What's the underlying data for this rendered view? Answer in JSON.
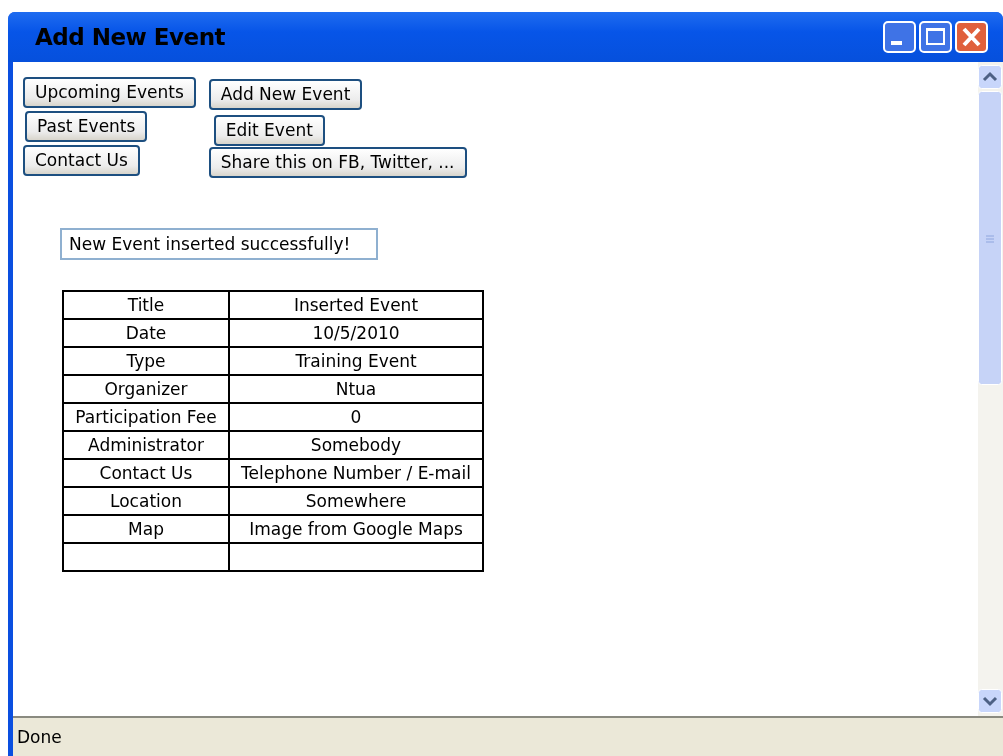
{
  "window": {
    "title": "Add New Event"
  },
  "nav_buttons": [
    {
      "label": "Upcoming Events"
    },
    {
      "label": "Past Events"
    },
    {
      "label": "Contact Us"
    }
  ],
  "action_buttons": [
    {
      "label": "Add New Event"
    },
    {
      "label": "Edit Event"
    },
    {
      "label": "Share this on FB, Twitter, ..."
    }
  ],
  "message": "New Event inserted successfully!",
  "table": {
    "rows": [
      [
        "Title",
        "Inserted Event"
      ],
      [
        "Date",
        "10/5/2010"
      ],
      [
        "Type",
        "Training Event"
      ],
      [
        "Organizer",
        "Ntua"
      ],
      [
        "Participation Fee",
        "0"
      ],
      [
        "Administrator",
        "Somebody"
      ],
      [
        "Contact Us",
        "Telephone Number / E-mail"
      ],
      [
        "Location",
        "Somewhere"
      ],
      [
        "Map",
        "Image from Google Maps"
      ],
      [
        "",
        ""
      ]
    ]
  },
  "status_bar": "Done"
}
